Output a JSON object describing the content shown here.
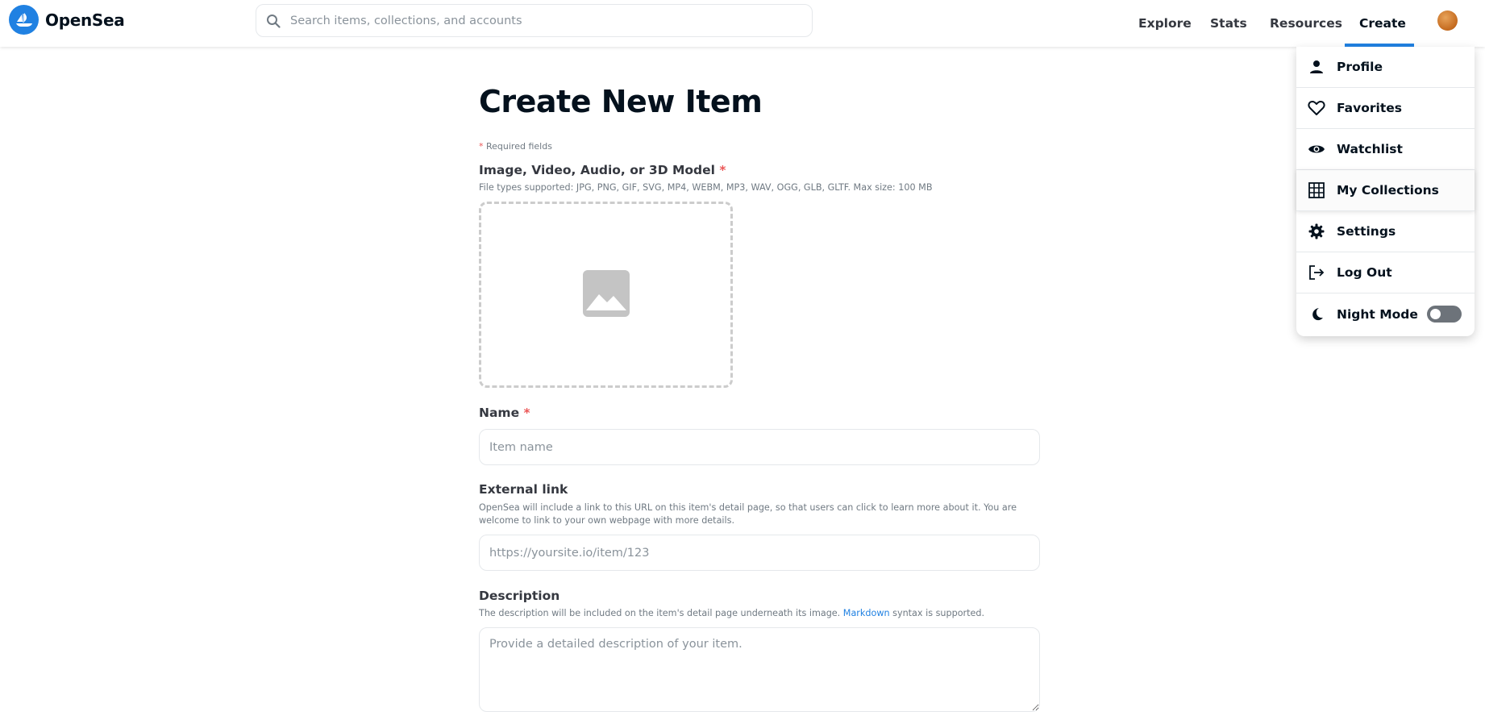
{
  "brand": {
    "name": "OpenSea",
    "color": "#2081e2"
  },
  "search": {
    "placeholder": "Search items, collections, and accounts",
    "value": ""
  },
  "nav": {
    "items": [
      {
        "label": "Explore"
      },
      {
        "label": "Stats"
      },
      {
        "label": "Resources"
      },
      {
        "label": "Create",
        "active": true
      }
    ]
  },
  "form": {
    "title": "Create New Item",
    "required_marker": "*",
    "required_note": "Required fields",
    "media": {
      "label": "Image, Video, Audio, or 3D Model",
      "help": "File types supported: JPG, PNG, GIF, SVG, MP4, WEBM, MP3, WAV, OGG, GLB, GLTF. Max size: 100 MB"
    },
    "name": {
      "label": "Name",
      "placeholder": "Item name",
      "value": ""
    },
    "external_link": {
      "label": "External link",
      "help": "OpenSea will include a link to this URL on this item's detail page, so that users can click to learn more about it. You are welcome to link to your own webpage with more details.",
      "placeholder": "https://yoursite.io/item/123",
      "value": ""
    },
    "description": {
      "label": "Description",
      "help_before": "The description will be included on the item's detail page underneath its image. ",
      "help_link": "Markdown",
      "help_after": " syntax is supported.",
      "placeholder": "Provide a detailed description of your item.",
      "value": ""
    }
  },
  "menu": {
    "items": [
      {
        "label": "Profile",
        "icon": "person-icon"
      },
      {
        "label": "Favorites",
        "icon": "heart-icon"
      },
      {
        "label": "Watchlist",
        "icon": "eye-icon"
      },
      {
        "label": "My Collections",
        "icon": "grid-icon"
      },
      {
        "label": "Settings",
        "icon": "gear-icon"
      },
      {
        "label": "Log Out",
        "icon": "logout-icon"
      },
      {
        "label": "Night Mode",
        "icon": "moon-icon",
        "toggle": false
      }
    ]
  }
}
